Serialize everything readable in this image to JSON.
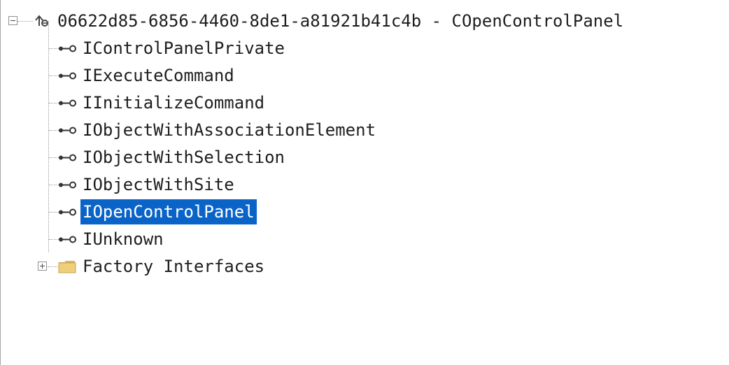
{
  "root": {
    "label": "06622d85-6856-4460-8de1-a81921b41c4b - COpenControlPanel",
    "expanded": true,
    "icon": "class-icon"
  },
  "interfaces": [
    {
      "label": "IControlPanelPrivate",
      "icon": "interface-icon",
      "selected": false
    },
    {
      "label": "IExecuteCommand",
      "icon": "interface-icon",
      "selected": false
    },
    {
      "label": "IInitializeCommand",
      "icon": "interface-icon",
      "selected": false
    },
    {
      "label": "IObjectWithAssociationElement",
      "icon": "interface-icon",
      "selected": false
    },
    {
      "label": "IObjectWithSelection",
      "icon": "interface-icon",
      "selected": false
    },
    {
      "label": "IObjectWithSite",
      "icon": "interface-icon",
      "selected": false
    },
    {
      "label": "IOpenControlPanel",
      "icon": "interface-icon",
      "selected": true
    },
    {
      "label": "IUnknown",
      "icon": "interface-icon",
      "selected": false
    }
  ],
  "factory": {
    "label": "Factory Interfaces",
    "expanded": false,
    "icon": "folder-icon"
  },
  "colors": {
    "selection_bg": "#0a64c8",
    "selection_text": "#ffffff",
    "text": "#1e1e1e"
  }
}
